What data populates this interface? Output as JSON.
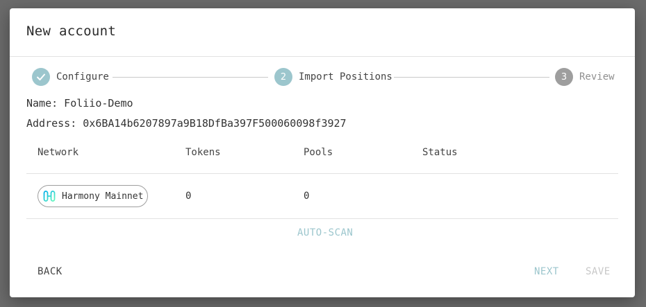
{
  "dialog": {
    "title": "New account"
  },
  "stepper": {
    "steps": [
      {
        "number": "1",
        "label": "Configure",
        "state": "completed"
      },
      {
        "number": "2",
        "label": "Import Positions",
        "state": "active"
      },
      {
        "number": "3",
        "label": "Review",
        "state": "upcoming"
      }
    ]
  },
  "account": {
    "name_line": "Name: Foliio-Demo",
    "address_line": "Address: 0x6BA14b6207897a9B18DfBa397F500060098f3927"
  },
  "table": {
    "headers": [
      "Network",
      "Tokens",
      "Pools",
      "Status"
    ],
    "rows": [
      {
        "network": "Harmony Mainnet",
        "network_icon": "harmony-logo-icon",
        "tokens": "0",
        "pools": "0",
        "status": ""
      }
    ]
  },
  "actions": {
    "autoscan_label": "AUTO-SCAN",
    "back_label": "BACK",
    "next_label": "NEXT",
    "save_label": "SAVE"
  },
  "colors": {
    "accent": "#9cc6cd",
    "inactive_step": "#9e9e9e",
    "disabled_text": "#c8c8c8"
  }
}
